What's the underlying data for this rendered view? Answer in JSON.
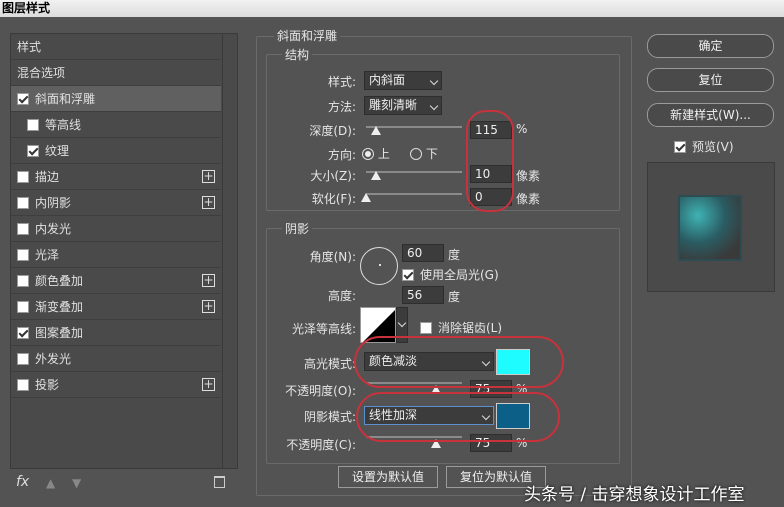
{
  "title": "图层样式",
  "left_panel": {
    "items": [
      {
        "label": "样式",
        "checkbox": false,
        "checked": false,
        "plus": false
      },
      {
        "label": "混合选项",
        "checkbox": false,
        "checked": false,
        "plus": false
      },
      {
        "label": "斜面和浮雕",
        "checkbox": true,
        "checked": true,
        "plus": false
      },
      {
        "label": "等高线",
        "checkbox": true,
        "checked": false,
        "plus": false
      },
      {
        "label": "纹理",
        "checkbox": true,
        "checked": true,
        "plus": false
      },
      {
        "label": "描边",
        "checkbox": true,
        "checked": false,
        "plus": true
      },
      {
        "label": "内阴影",
        "checkbox": true,
        "checked": false,
        "plus": true
      },
      {
        "label": "内发光",
        "checkbox": true,
        "checked": false,
        "plus": false
      },
      {
        "label": "光泽",
        "checkbox": true,
        "checked": false,
        "plus": false
      },
      {
        "label": "颜色叠加",
        "checkbox": true,
        "checked": false,
        "plus": true
      },
      {
        "label": "渐变叠加",
        "checkbox": true,
        "checked": false,
        "plus": true
      },
      {
        "label": "图案叠加",
        "checkbox": true,
        "checked": true,
        "plus": false
      },
      {
        "label": "外发光",
        "checkbox": true,
        "checked": false,
        "plus": false
      },
      {
        "label": "投影",
        "checkbox": true,
        "checked": false,
        "plus": true
      }
    ],
    "fx_label": "fx"
  },
  "bevel": {
    "group_title": "斜面和浮雕",
    "structure_title": "结构",
    "style_label": "样式:",
    "style_value": "内斜面",
    "method_label": "方法:",
    "method_value": "雕刻清晰",
    "depth_label": "深度(D):",
    "depth_value": "115",
    "depth_unit": "%",
    "direction_label": "方向:",
    "direction_up": "上",
    "direction_down": "下",
    "size_label": "大小(Z):",
    "size_value": "10",
    "size_unit": "像素",
    "soften_label": "软化(F):",
    "soften_value": "0",
    "soften_unit": "像素"
  },
  "shading": {
    "title": "阴影",
    "angle_label": "角度(N):",
    "angle_value": "60",
    "angle_unit": "度",
    "global_light_label": "使用全局光(G)",
    "altitude_label": "高度:",
    "altitude_value": "56",
    "altitude_unit": "度",
    "gloss_label": "光泽等高线:",
    "antialias_label": "消除锯齿(L)",
    "highlight_label": "高光模式:",
    "highlight_value": "颜色减淡",
    "highlight_color": "#1efcff",
    "highlight_opacity_label": "不透明度(O):",
    "highlight_opacity_value": "75",
    "shadow_label": "阴影模式:",
    "shadow_value": "线性加深",
    "shadow_color": "#0c5f86",
    "shadow_opacity_label": "不透明度(C):",
    "shadow_opacity_value": "75",
    "percent": "%"
  },
  "buttons": {
    "make_default": "设置为默认值",
    "reset_default": "复位为默认值",
    "ok": "确定",
    "reset": "复位",
    "new_style": "新建样式(W)...",
    "preview_label": "预览(V)"
  },
  "watermark": "头条号 / 击穿想象设计工作室"
}
